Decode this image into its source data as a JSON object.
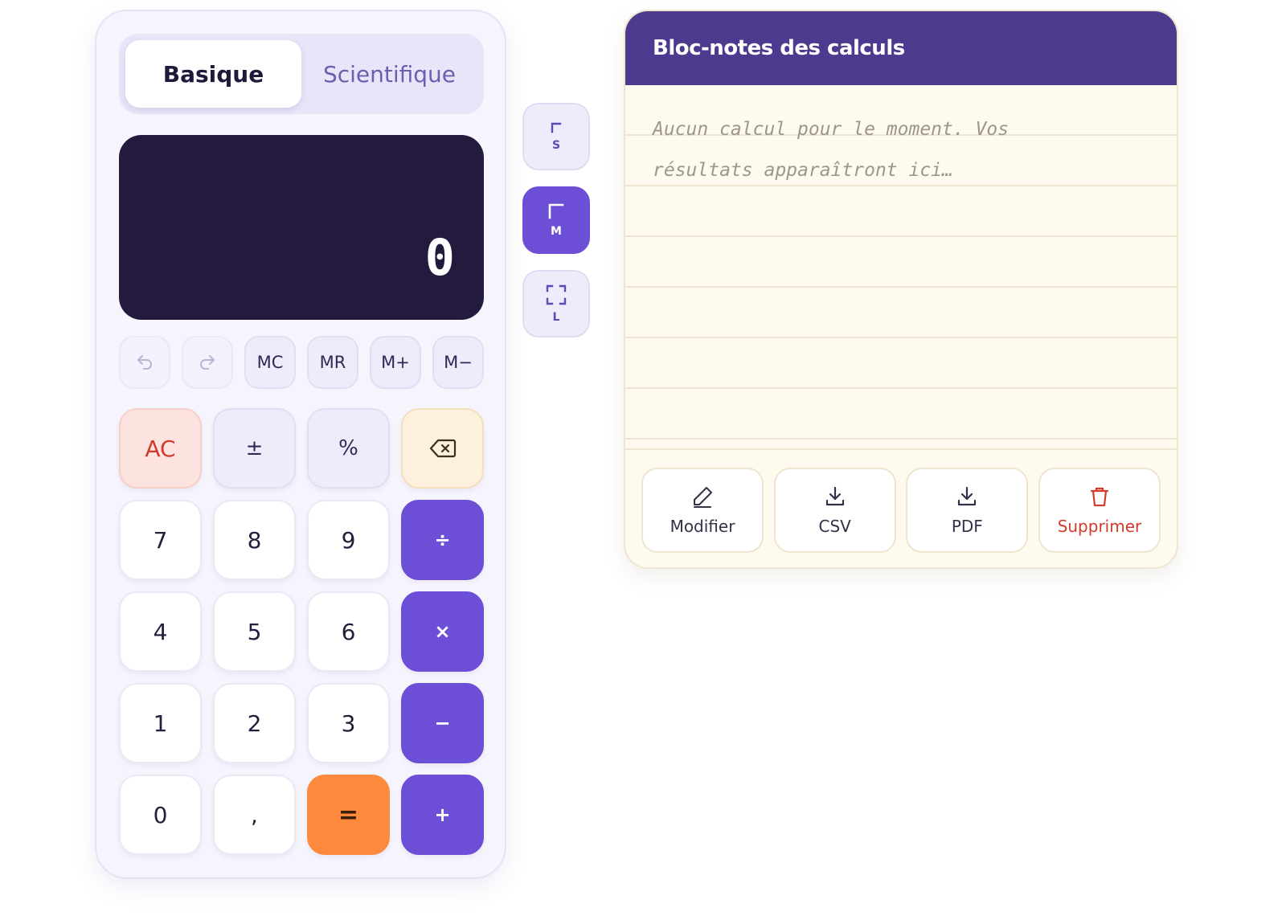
{
  "calculator": {
    "tabs": [
      {
        "label": "Basique",
        "active": true
      },
      {
        "label": "Scientifique",
        "active": false
      }
    ],
    "display": {
      "value": "0"
    },
    "memory": [
      {
        "label": "",
        "icon": "undo-icon",
        "enabled": false
      },
      {
        "label": "",
        "icon": "redo-icon",
        "enabled": false
      },
      {
        "label": "MC",
        "enabled": true
      },
      {
        "label": "MR",
        "enabled": true
      },
      {
        "label": "M+",
        "enabled": true
      },
      {
        "label": "M−",
        "enabled": true
      }
    ],
    "keys": {
      "clear": "AC",
      "sign": "±",
      "percent": "%",
      "backspace_icon": "backspace-icon",
      "seven": "7",
      "eight": "8",
      "nine": "9",
      "divide": "÷",
      "four": "4",
      "five": "5",
      "six": "6",
      "multiply": "×",
      "one": "1",
      "two": "2",
      "three": "3",
      "minus": "−",
      "zero": "0",
      "decimal": ",",
      "equals": "=",
      "plus": "+"
    }
  },
  "size_selector": {
    "options": [
      {
        "label": "S",
        "active": false,
        "icon": "corner-small-icon"
      },
      {
        "label": "M",
        "active": true,
        "icon": "corner-medium-icon"
      },
      {
        "label": "L",
        "active": false,
        "icon": "expand-icon"
      }
    ]
  },
  "notepad": {
    "title": "Bloc-notes des calculs",
    "placeholder": "Aucun calcul pour le moment. Vos résultats apparaîtront ici…",
    "actions": [
      {
        "label": "Modifier",
        "icon": "pencil-icon"
      },
      {
        "label": "CSV",
        "icon": "download-icon"
      },
      {
        "label": "PDF",
        "icon": "download-icon"
      },
      {
        "label": "Supprimer",
        "icon": "trash-icon"
      }
    ]
  },
  "colors": {
    "accent": "#6c4fd6",
    "equals": "#fd8a3d",
    "display_bg": "#231a3d",
    "notepad_header": "#4d3a8e",
    "danger": "#d23b2c"
  }
}
